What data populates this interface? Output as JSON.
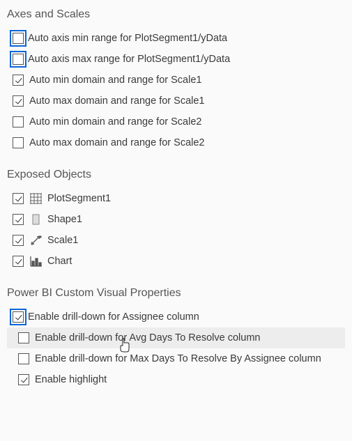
{
  "sections": {
    "axes": {
      "title": "Axes and Scales",
      "items": [
        {
          "label": "Auto axis min range for PlotSegment1/yData",
          "checked": false,
          "selected": true
        },
        {
          "label": "Auto axis max range for PlotSegment1/yData",
          "checked": false,
          "selected": true
        },
        {
          "label": "Auto min domain and range for Scale1",
          "checked": true,
          "selected": false
        },
        {
          "label": "Auto max domain and range for Scale1",
          "checked": true,
          "selected": false
        },
        {
          "label": "Auto min domain and range for Scale2",
          "checked": false,
          "selected": false
        },
        {
          "label": "Auto max domain and range for Scale2",
          "checked": false,
          "selected": false
        }
      ]
    },
    "exposed": {
      "title": "Exposed Objects",
      "items": [
        {
          "label": "PlotSegment1",
          "checked": true,
          "icon": "grid"
        },
        {
          "label": "Shape1",
          "checked": true,
          "icon": "rect"
        },
        {
          "label": "Scale1",
          "checked": true,
          "icon": "scale"
        },
        {
          "label": "Chart",
          "checked": true,
          "icon": "chart"
        }
      ]
    },
    "pbi": {
      "title": "Power BI Custom Visual Properties",
      "items": [
        {
          "label": "Enable drill-down for Assignee column",
          "checked": true,
          "selected": true,
          "indent": false,
          "hover": false
        },
        {
          "label": "Enable drill-down for Avg Days To Resolve column",
          "checked": false,
          "selected": false,
          "indent": true,
          "hover": true
        },
        {
          "label": "Enable drill-down for Max Days To Resolve By Assignee column",
          "checked": false,
          "selected": false,
          "indent": true,
          "hover": false
        },
        {
          "label": "Enable highlight",
          "checked": true,
          "selected": false,
          "indent": true,
          "hover": false
        }
      ]
    }
  }
}
